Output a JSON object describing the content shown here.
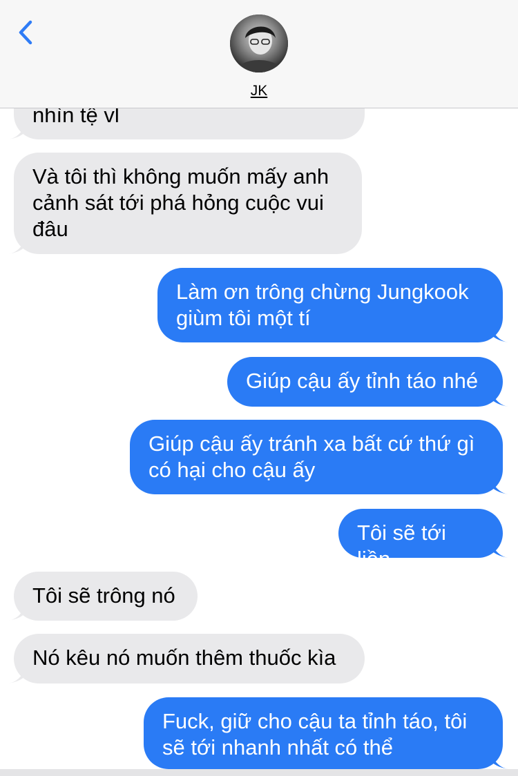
{
  "contact": {
    "name": "JK"
  },
  "colors": {
    "incoming": "#e9e9eb",
    "outgoing": "#2a7bf5",
    "back": "#2f7cf6"
  },
  "messages": [
    {
      "dir": "in",
      "text": "nhìn tệ vl"
    },
    {
      "dir": "in",
      "text": "Và tôi thì không muốn mấy anh cảnh sát tới phá hỏng cuộc vui đâu"
    },
    {
      "dir": "out",
      "text": "Làm ơn trông chừng Jungkook giùm tôi một tí"
    },
    {
      "dir": "out",
      "text": "Giúp cậu ấy tỉnh táo nhé"
    },
    {
      "dir": "out",
      "text": "Giúp cậu ấy tránh xa bất cứ thứ gì có hại cho cậu ấy"
    },
    {
      "dir": "out",
      "text": "Tôi sẽ tới liền"
    },
    {
      "dir": "in",
      "text": "Tôi sẽ trông nó"
    },
    {
      "dir": "in",
      "text": "Nó kêu nó muốn thêm thuốc kìa"
    },
    {
      "dir": "out",
      "text": "Fuck, giữ cho cậu ta tỉnh táo, tôi sẽ tới nhanh nhất có thể"
    }
  ]
}
